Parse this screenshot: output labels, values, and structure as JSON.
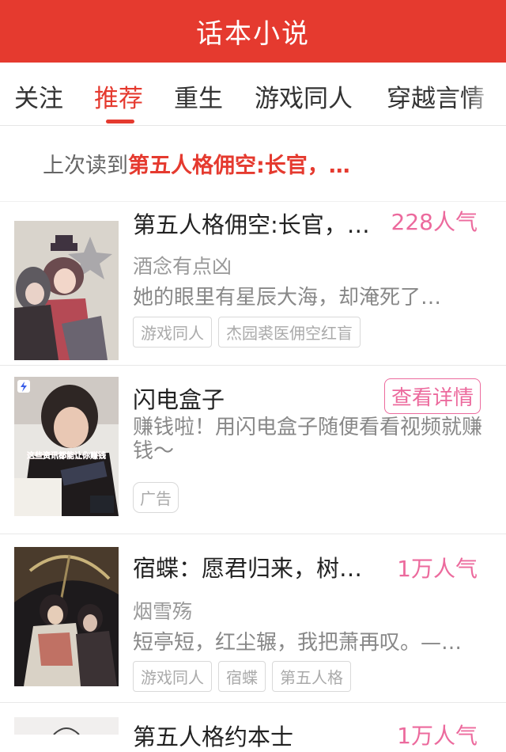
{
  "header": {
    "title": "话本小说"
  },
  "tabs": [
    {
      "label": "关注",
      "active": false
    },
    {
      "label": "推荐",
      "active": true
    },
    {
      "label": "重生",
      "active": false
    },
    {
      "label": "游戏同人",
      "active": false
    },
    {
      "label": "穿越言情",
      "active": false
    }
  ],
  "last_read": {
    "prefix": "上次读到",
    "book": "第五人格佣空:长官，…"
  },
  "books": [
    {
      "title": "第五人格佣空:长官，…",
      "popularity": "228人气",
      "author": "酒念有点凶",
      "description": "她的眼里有星辰大海，却淹死了…",
      "tags": [
        "游戏同人",
        "杰园裘医佣空红盲"
      ]
    },
    {
      "title": "闪电盒子",
      "action_label": "查看详情",
      "description": "赚钱啦！用闪电盒子随便看看视频就赚钱～",
      "tags": [
        "广告"
      ],
      "cover_caption": "这些资讯都能让你赚钱"
    },
    {
      "title": "宿蝶：愿君归来，树…",
      "popularity": "1万人气",
      "author": "烟雪殇",
      "description": "短亭短，红尘辗，我把萧再叹。—…",
      "tags": [
        "游戏同人",
        "宿蝶",
        "第五人格"
      ]
    },
    {
      "title": "第五人格约本士",
      "popularity": "1万人气"
    }
  ],
  "colors": {
    "brand": "#e53a2f",
    "accent": "#ec6a9d"
  }
}
